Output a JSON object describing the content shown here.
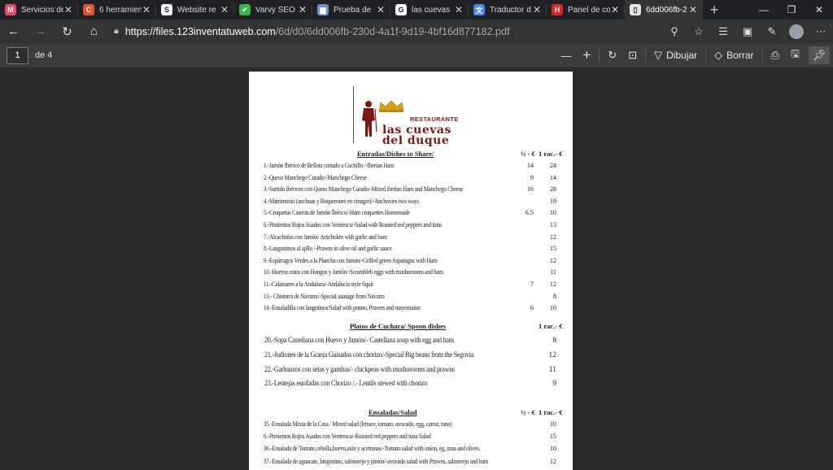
{
  "browser": {
    "tabs": [
      {
        "title": "Servicios de",
        "icon": "m-logo-icon",
        "color": "#e84a6a",
        "glyph": "M"
      },
      {
        "title": "6 herramien",
        "icon": "c-logo-icon",
        "color": "#e2522a",
        "glyph": "C"
      },
      {
        "title": "Website re",
        "icon": "s-logo-icon",
        "color": "#ffffff",
        "glyph": "S"
      },
      {
        "title": "Varvy SEO",
        "icon": "check-logo-icon",
        "color": "#3bb44a",
        "glyph": "✔"
      },
      {
        "title": "Prueba de",
        "icon": "car-logo-icon",
        "color": "#6c8fd6",
        "glyph": "▆"
      },
      {
        "title": "las cuevas",
        "icon": "google-logo-icon",
        "color": "#ffffff",
        "glyph": "G"
      },
      {
        "title": "Traductor d",
        "icon": "translate-logo-icon",
        "color": "#4a86f0",
        "glyph": "文"
      },
      {
        "title": "Panel de co",
        "icon": "h-logo-icon",
        "color": "#d9262b",
        "glyph": "H"
      },
      {
        "title": "6dd006fb-2",
        "icon": "pdf-page-icon",
        "color": "#e6e6e6",
        "glyph": "▯"
      }
    ],
    "active_tab": 8,
    "url_host": "https://files.123inventatuweb.com",
    "url_path": "/6d/d0/6dd006fb-230d-4a1f-9d19-4bf16d877182.pdf"
  },
  "pdf_toolbar": {
    "page_current": "1",
    "page_total": "de 4",
    "draw_label": "Dibujar",
    "erase_label": "Borrar"
  },
  "logo": {
    "restaurante": "RESTAURANTE",
    "name_line1": "las cuevas",
    "name_line2": "del duque"
  },
  "sections": [
    {
      "title": "Entradas/Dishes to Share/",
      "col1": "½ - €",
      "col2": "1 rac.- €",
      "big": false,
      "items": [
        {
          "desc": "1.-Jamón Ibérico de Bellota cortado a Cuchillo /-Iberian Ham",
          "p1": "14",
          "p2": "24"
        },
        {
          "desc": "2.-Queso Manchego Curado/-Manchego Cheese",
          "p1": "9",
          "p2": "14"
        },
        {
          "desc": "3.-Surtido Ibéricos con Queso Manchego Curado/-Mixed iberian Ham and Manchego Cheese",
          "p1": "16",
          "p2": "28"
        },
        {
          "desc": "4.-Matrimonio (anchoas y Boquerones en vinagre)/-Anchovies two ways",
          "p1": "",
          "p2": "19"
        },
        {
          "desc": "5.-Croquetas Caseras de Jamón Ibérico/-Ham croquettes Homemade",
          "p1": "6.5",
          "p2": "10"
        },
        {
          "desc": "6.-Pimientos Rojos Asados con Ventresca/-Salad with Roasted red peppers and tuna",
          "p1": "",
          "p2": "13"
        },
        {
          "desc": "7.-Alcachofas con Jamón/ Artichokes with garlic and ham",
          "p1": "",
          "p2": "12"
        },
        {
          "desc": "8.-Langostinos al ajillo /-Prawns in olive oil and garlic sauce",
          "p1": "",
          "p2": "15"
        },
        {
          "desc": "9.-Espárragos Verdes a la Plancha con Jamón/-Grilled green Asparagus with Ham",
          "p1": "",
          "p2": "12"
        },
        {
          "desc": "10.-Huevos rotos con Hongos y Jamón/-Scrambleb eggs with mushorooms and ham",
          "p1": "",
          "p2": "11"
        },
        {
          "desc": "11.-Calamares a la Andaluza/-Andalucia style Squit",
          "p1": "7",
          "p2": "12"
        },
        {
          "desc": "13.- Chistorra de Navarra/-Special sausage from Navarra",
          "p1": "",
          "p2": "8"
        },
        {
          "desc": "14.-Ensaladilla con langotinos/Salad with potato, Prawns and mayonnaise",
          "p1": "6",
          "p2": "10"
        }
      ]
    },
    {
      "title": "Platos de Cuchara/ Spoon dishes",
      "col1": "",
      "col2": "1 rac.- €",
      "big": true,
      "items": [
        {
          "desc": "20.-Sopa Castellana con Huevo y Jamón/- Castellana soup with egg and ham",
          "p1": "",
          "p2": "8"
        },
        {
          "desc": "21.-Judiones de la Granja Guisados con chorizo/-Special Big beans from the Segovia",
          "p1": "",
          "p2": "12"
        },
        {
          "desc": "22.-Garbanzos  con setas y gambas/- chickpeas with mushorooms and prawns",
          "p1": "",
          "p2": "11"
        },
        {
          "desc": "23.-Lentejas estofadas con Chorizo /.- Lentils stewed with chorizo",
          "p1": "",
          "p2": "9"
        }
      ]
    },
    {
      "title": "Ensaladas/Salad",
      "col1": "½ - €",
      "col2": "1 rac.- €",
      "big": false,
      "items": [
        {
          "desc": "35.-Ensalada Mixta de la Casa / Mixed salad (lettuce, tomato, avocado, egg, carrot, tuna)",
          "p1": "",
          "p2": "10"
        },
        {
          "desc": "6.-Pimientos Rojos Asados con Ventresca/-Roasted red peppers and tuna Salad",
          "p1": "",
          "p2": "15"
        },
        {
          "desc": "36.-Ensalada de Tomate,cebolla,huevo,atún y aceitunas/-Tomato salad with onion, eg, tuna and olives.",
          "p1": "",
          "p2": "10"
        },
        {
          "desc": "37.-Ensalada de aguacate, langostino, salmorejo y jamón/-avocado salad with Prawns, salmorejo and ham",
          "p1": "",
          "p2": "12"
        }
      ]
    }
  ]
}
